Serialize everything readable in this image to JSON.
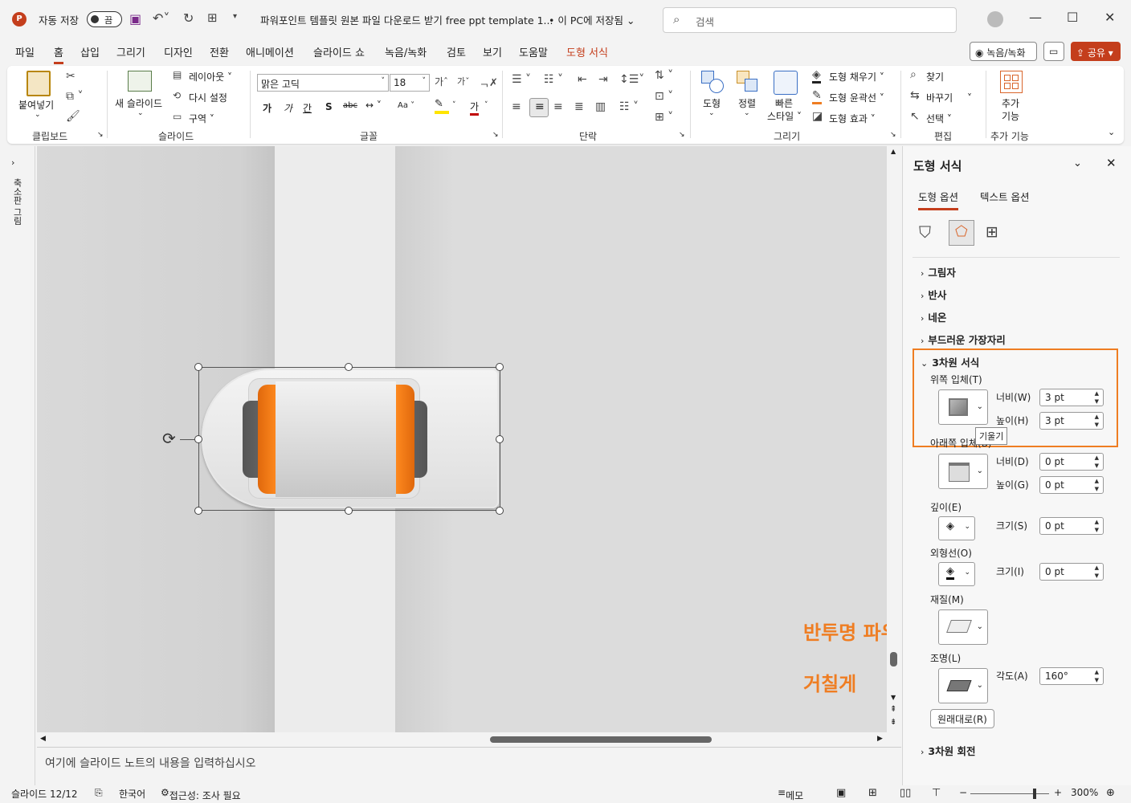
{
  "title_bar": {
    "autosave_label": "자동 저장",
    "autosave_state": "끔",
    "document_title": "파워포인트 템플릿 원본 파일 다운로드 받기 free ppt template 1...",
    "save_location": "• 이 PC에 저장됨",
    "search_placeholder": "검색"
  },
  "menu": {
    "tabs": [
      "파일",
      "홈",
      "삽입",
      "그리기",
      "디자인",
      "전환",
      "애니메이션",
      "슬라이드 쇼",
      "녹음/녹화",
      "검토",
      "보기",
      "도움말",
      "도형 서식"
    ],
    "active_tab": "홈",
    "record_button": "녹음/녹화",
    "share_button": "공유"
  },
  "ribbon": {
    "clipboard": {
      "paste": "붙여넣기",
      "group": "클립보드"
    },
    "slides": {
      "new_slide": "새 슬라이드",
      "layout": "레이아웃",
      "reset": "다시 설정",
      "section": "구역",
      "group": "슬라이드"
    },
    "font": {
      "name": "맑은 고딕",
      "size": "18",
      "bold": "가",
      "italic": "가",
      "underline": "간",
      "strike": "S",
      "charspace": "가",
      "text_color": "가",
      "group": "글꼴"
    },
    "paragraph": {
      "group": "단락"
    },
    "drawing": {
      "shapes": "도형",
      "arrange": "정렬",
      "quick_styles_1": "빠른",
      "quick_styles_2": "스타일",
      "fill": "도형 채우기",
      "outline": "도형 윤곽선",
      "effects": "도형 효과",
      "group": "그리기"
    },
    "editing": {
      "find": "찾기",
      "replace": "바꾸기",
      "select": "선택",
      "group": "편집"
    },
    "addins": {
      "label_1": "추가",
      "label_2": "기능",
      "group": "추가 기능"
    }
  },
  "left_strip": {
    "label": "축소판 그림"
  },
  "notes": {
    "placeholder": "여기에 슬라이드 노트의 내용을 입력하십시오"
  },
  "format_pane": {
    "title": "도형 서식",
    "tabs": [
      "도형 옵션",
      "텍스트 옵션"
    ],
    "sections": {
      "shadow": "그림자",
      "reflection": "반사",
      "glow": "네온",
      "soft_edges": "부드러운 가장자리",
      "format_3d": "3차원 서식",
      "rotation_3d": "3차원 회전"
    },
    "top_bevel": {
      "label": "위쪽 입체(T)",
      "width_label": "너비(W)",
      "width_value": "3 pt",
      "height_label": "높이(H)",
      "height_value": "3 pt",
      "tooltip": "기울기"
    },
    "bottom_bevel": {
      "label": "아래쪽 입체(B)",
      "width_label": "너비(D)",
      "width_value": "0 pt",
      "height_label": "높이(G)",
      "height_value": "0 pt"
    },
    "depth": {
      "label": "깊이(E)",
      "size_label": "크기(S)",
      "size_value": "0 pt"
    },
    "contour": {
      "label": "외형선(O)",
      "size_label": "크기(I)",
      "size_value": "0 pt"
    },
    "material": {
      "label": "재질(M)"
    },
    "lighting": {
      "label": "조명(L)",
      "angle_label": "각도(A)",
      "angle_value": "160°"
    },
    "reset_button": "원래대로(R)"
  },
  "annotations": {
    "material_note": "반투명 파우더",
    "lighting_note": "거칠게"
  },
  "status_bar": {
    "slide_info": "슬라이드 12/12",
    "language": "한국어",
    "accessibility": "접근성: 조사 필요",
    "notes_button": "메모",
    "zoom": "300%"
  },
  "colors": {
    "accent": "#c43e1c",
    "highlight_box": "#ef7d22",
    "annotation": "#ef7d22"
  }
}
